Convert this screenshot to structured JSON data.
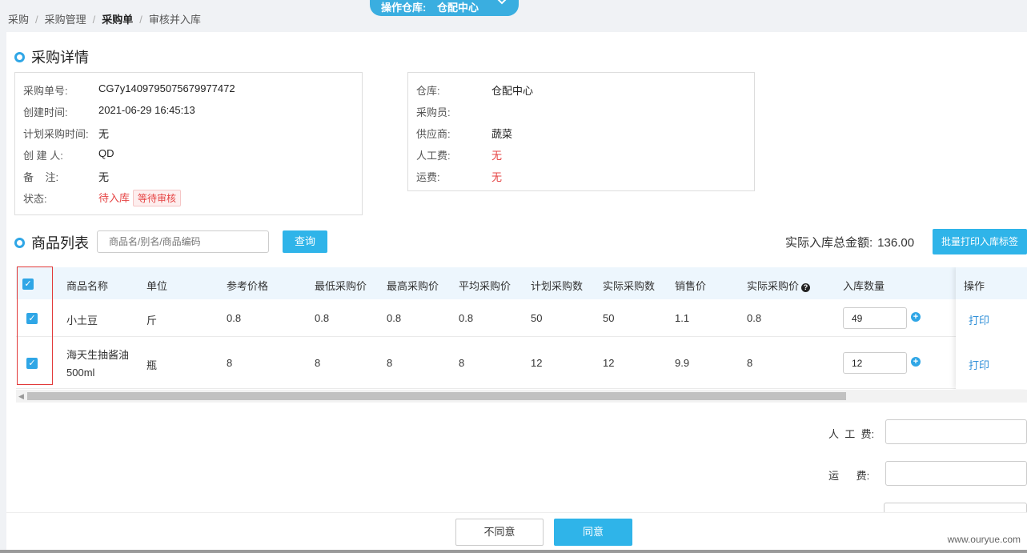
{
  "breadcrumb": [
    "采购",
    "采购管理",
    "采购单",
    "审核并入库"
  ],
  "warehouse_pill": {
    "label": "操作仓库:",
    "value": "仓配中心",
    "icon": "chevron-down-icon"
  },
  "detail": {
    "title": "采购详情",
    "left": [
      {
        "key": "采购单号:",
        "value": "CG7y1409795075679977472"
      },
      {
        "key": "创建时间:",
        "value": "2021-06-29 16:45:13"
      },
      {
        "key": "计划采购时间:",
        "value": "无"
      },
      {
        "key": "创 建 人:",
        "value": "QD"
      },
      {
        "key": "备    注:",
        "value": "无"
      },
      {
        "key": "状态:",
        "value": "待入库",
        "tag": "等待审核"
      }
    ],
    "right": [
      {
        "key": "仓库:",
        "value": "仓配中心"
      },
      {
        "key": "采购员:",
        "value": ""
      },
      {
        "key": "供应商:",
        "value": "蔬菜"
      },
      {
        "key": "人工费:",
        "value": "无"
      },
      {
        "key": "运费:",
        "value": "无"
      }
    ]
  },
  "goods": {
    "title": "商品列表",
    "search_placeholder": "商品名/别名/商品编码",
    "search_button": "查询",
    "total_label": "实际入库总金额:",
    "total_value": "136.00",
    "batch_print_button": "批量打印入库标签",
    "columns": [
      "商品名称",
      "单位",
      "参考价格",
      "最低采购价",
      "最高采购价",
      "平均采购价",
      "计划采购数",
      "实际采购数",
      "销售价",
      "实际采购价",
      "入库数量",
      "操作"
    ],
    "rows": [
      {
        "name": "小土豆",
        "name2": "",
        "unit": "斤",
        "ref": "0.8",
        "min": "0.8",
        "max": "0.8",
        "avg": "0.8",
        "plan": "50",
        "actual": "50",
        "sale": "1.1",
        "actual_price": "0.8",
        "qty": "49",
        "op": "打印"
      },
      {
        "name": "海天生抽酱油",
        "name2": "500ml",
        "unit": "瓶",
        "ref": "8",
        "min": "8",
        "max": "8",
        "avg": "8",
        "plan": "12",
        "actual": "12",
        "sale": "9.9",
        "actual_price": "8",
        "qty": "12",
        "op": "打印"
      }
    ]
  },
  "fees": {
    "labor_label": "人  工  费:",
    "freight_label": "运      费:"
  },
  "footer": {
    "disagree": "不同意",
    "agree": "同意"
  },
  "watermark": "www.ouryue.com",
  "colors": {
    "accent": "#2fb4e9",
    "red": "#e64444",
    "header_bg": "#edf6fd"
  }
}
